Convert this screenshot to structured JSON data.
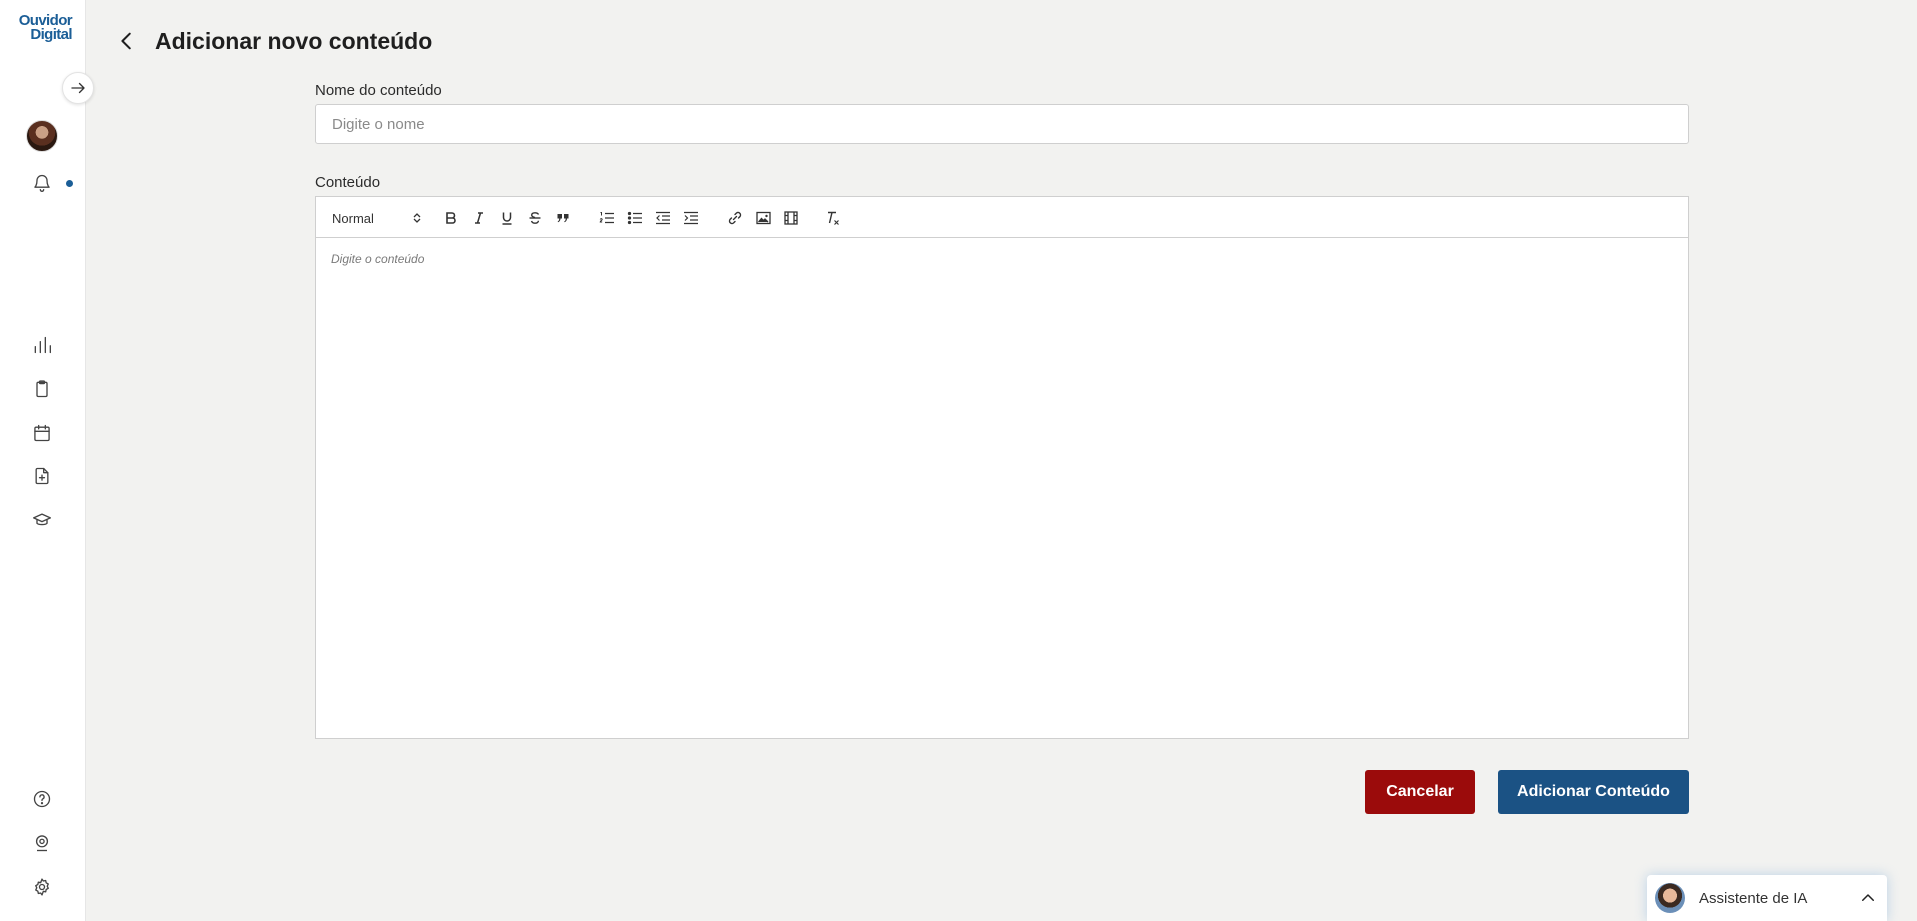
{
  "logo": {
    "line1": "Ouvidor",
    "line2": "Digital"
  },
  "header": {
    "title": "Adicionar novo conteúdo"
  },
  "form": {
    "name_label": "Nome do conteúdo",
    "name_placeholder": "Digite o nome",
    "content_label": "Conteúdo",
    "editor_placeholder": "Digite o conteúdo",
    "format_selected": "Normal"
  },
  "actions": {
    "cancel_label": "Cancelar",
    "submit_label": "Adicionar Conteúdo"
  },
  "assistant": {
    "label": "Assistente de IA"
  },
  "colors": {
    "brand": "#1b5e97",
    "cancel": "#9b0b0b",
    "submit": "#1b5284",
    "background": "#f2f2f0"
  },
  "icons": {
    "sidebar_top": [
      "arrow-right-icon",
      "bell-icon"
    ],
    "sidebar_main": [
      "bar-chart-icon",
      "clipboard-icon",
      "calendar-icon",
      "file-plus-icon",
      "graduation-cap-icon"
    ],
    "sidebar_bottom": [
      "help-circle-icon",
      "location-pin-icon",
      "gear-icon"
    ],
    "toolbar": [
      "bold-icon",
      "italic-icon",
      "underline-icon",
      "strikethrough-icon",
      "quote-icon",
      "ordered-list-icon",
      "bullet-list-icon",
      "outdent-icon",
      "indent-icon",
      "link-icon",
      "image-icon",
      "video-icon",
      "clear-format-icon"
    ]
  }
}
